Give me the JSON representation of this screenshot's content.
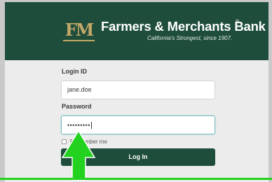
{
  "header": {
    "logo_text": "FM",
    "bank_name": "Farmers & Merchants Bank",
    "registered_mark": "®",
    "tagline": "California's Strongest, since 1907.",
    "background_color": "#1e4d3b",
    "logo_color": "#c3a868"
  },
  "form": {
    "login_id_label": "Login ID",
    "login_id_value": "jane.doe",
    "password_label": "Password",
    "password_value": "•••••••••",
    "remember_me_label": "Remember me",
    "remember_me_checked": false,
    "login_button_label": "Log In"
  },
  "annotation": {
    "arrow_icon": "up-arrow-icon",
    "arrow_color": "#22d21e"
  }
}
